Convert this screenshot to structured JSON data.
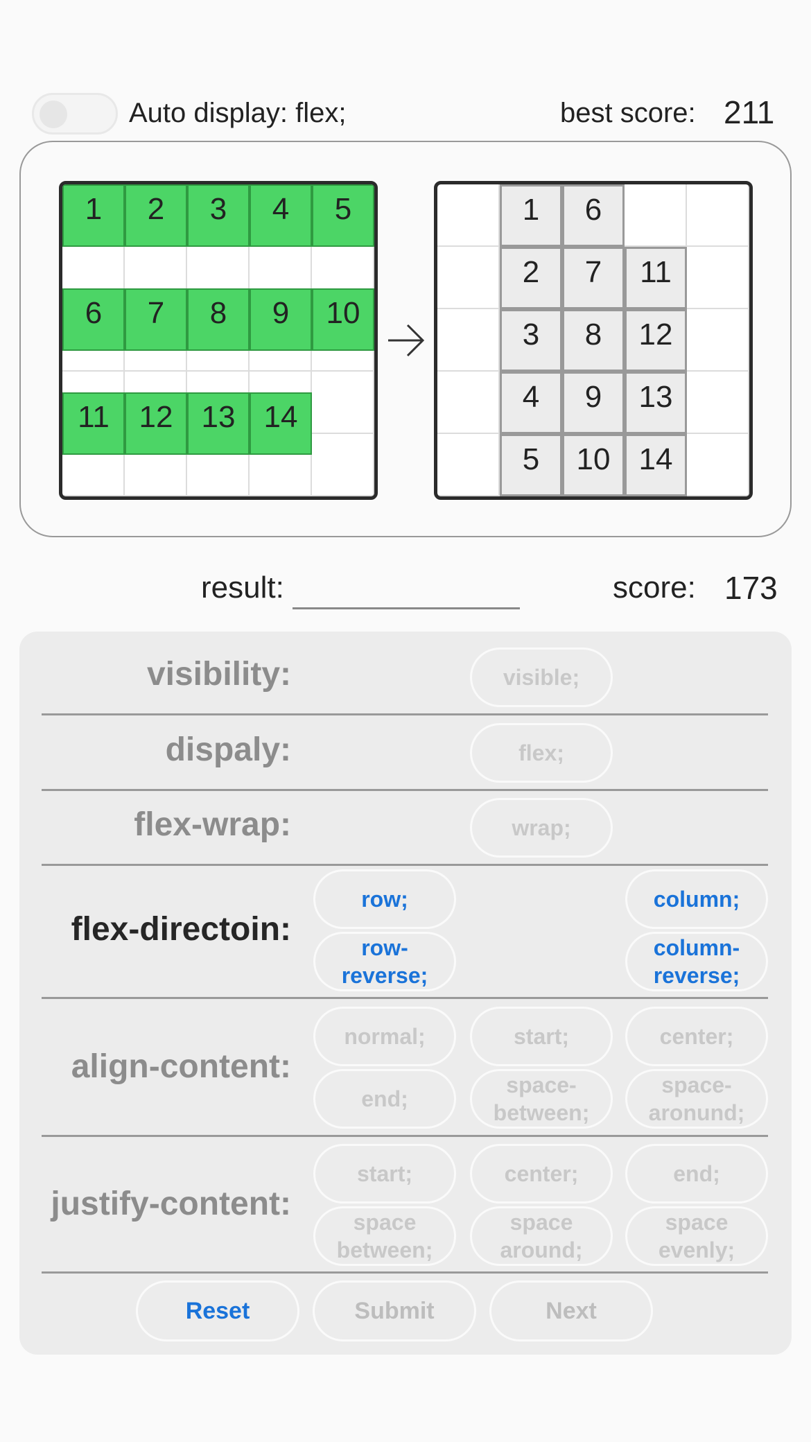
{
  "header": {
    "auto_label": "Auto display: flex;",
    "best_score_label": "best score:",
    "best_score_value": "211"
  },
  "puzzle": {
    "source_tiles": [
      "1",
      "2",
      "3",
      "4",
      "5",
      "6",
      "7",
      "8",
      "9",
      "10",
      "11",
      "12",
      "13",
      "14"
    ],
    "target_tiles": [
      "1",
      "2",
      "3",
      "4",
      "5",
      "6",
      "7",
      "8",
      "9",
      "10",
      "11",
      "12",
      "13",
      "14"
    ]
  },
  "result": {
    "label": "result:",
    "value": "",
    "score_label": "score:",
    "score_value": "173"
  },
  "properties": {
    "visibility": {
      "label": "visibility:",
      "options": [
        "visible;"
      ]
    },
    "display": {
      "label": "dispaly:",
      "options": [
        "flex;"
      ]
    },
    "flex_wrap": {
      "label": "flex-wrap:",
      "options": [
        "wrap;"
      ]
    },
    "flex_direction": {
      "label": "flex-directoin:",
      "options": [
        "row;",
        "column;",
        "row-\nreverse;",
        "column-\nreverse;"
      ]
    },
    "align_content": {
      "label": "align-content:",
      "options": [
        "normal;",
        "start;",
        "center;",
        "end;",
        "space-\nbetween;",
        "space-\naronund;"
      ]
    },
    "justify_content": {
      "label": "justify-content:",
      "options": [
        "start;",
        "center;",
        "end;",
        "space\nbetween;",
        "space\naround;",
        "space\nevenly;"
      ]
    }
  },
  "buttons": {
    "reset": "Reset",
    "submit": "Submit",
    "next": "Next"
  },
  "colors": {
    "tile_green": "#4cd566",
    "tile_grey": "#ececec",
    "accent_blue": "#1a73d9"
  }
}
